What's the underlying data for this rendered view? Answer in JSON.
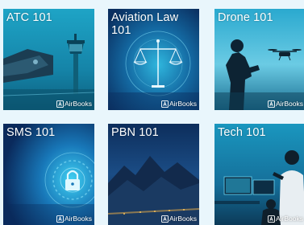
{
  "courses": [
    {
      "title": "ATC 101",
      "publisher": "AirBooks",
      "icon": "airbooks-logo-icon"
    },
    {
      "title": "Aviation Law\n101",
      "publisher": "AirBooks",
      "icon": "airbooks-logo-icon"
    },
    {
      "title": "Drone 101",
      "publisher": "AirBooks",
      "icon": "airbooks-logo-icon"
    },
    {
      "title": "SMS 101",
      "publisher": "AirBooks",
      "icon": "airbooks-logo-icon"
    },
    {
      "title": "PBN 101",
      "publisher": "AirBooks",
      "icon": "airbooks-logo-icon"
    },
    {
      "title": "Tech 101",
      "publisher": "AirBooks",
      "icon": "airbooks-logo-icon"
    }
  ],
  "colors": {
    "page_background": "#e9f6fc",
    "card_teal": "#1a8fae",
    "card_navy": "#0b2a57",
    "text": "#ffffff"
  }
}
